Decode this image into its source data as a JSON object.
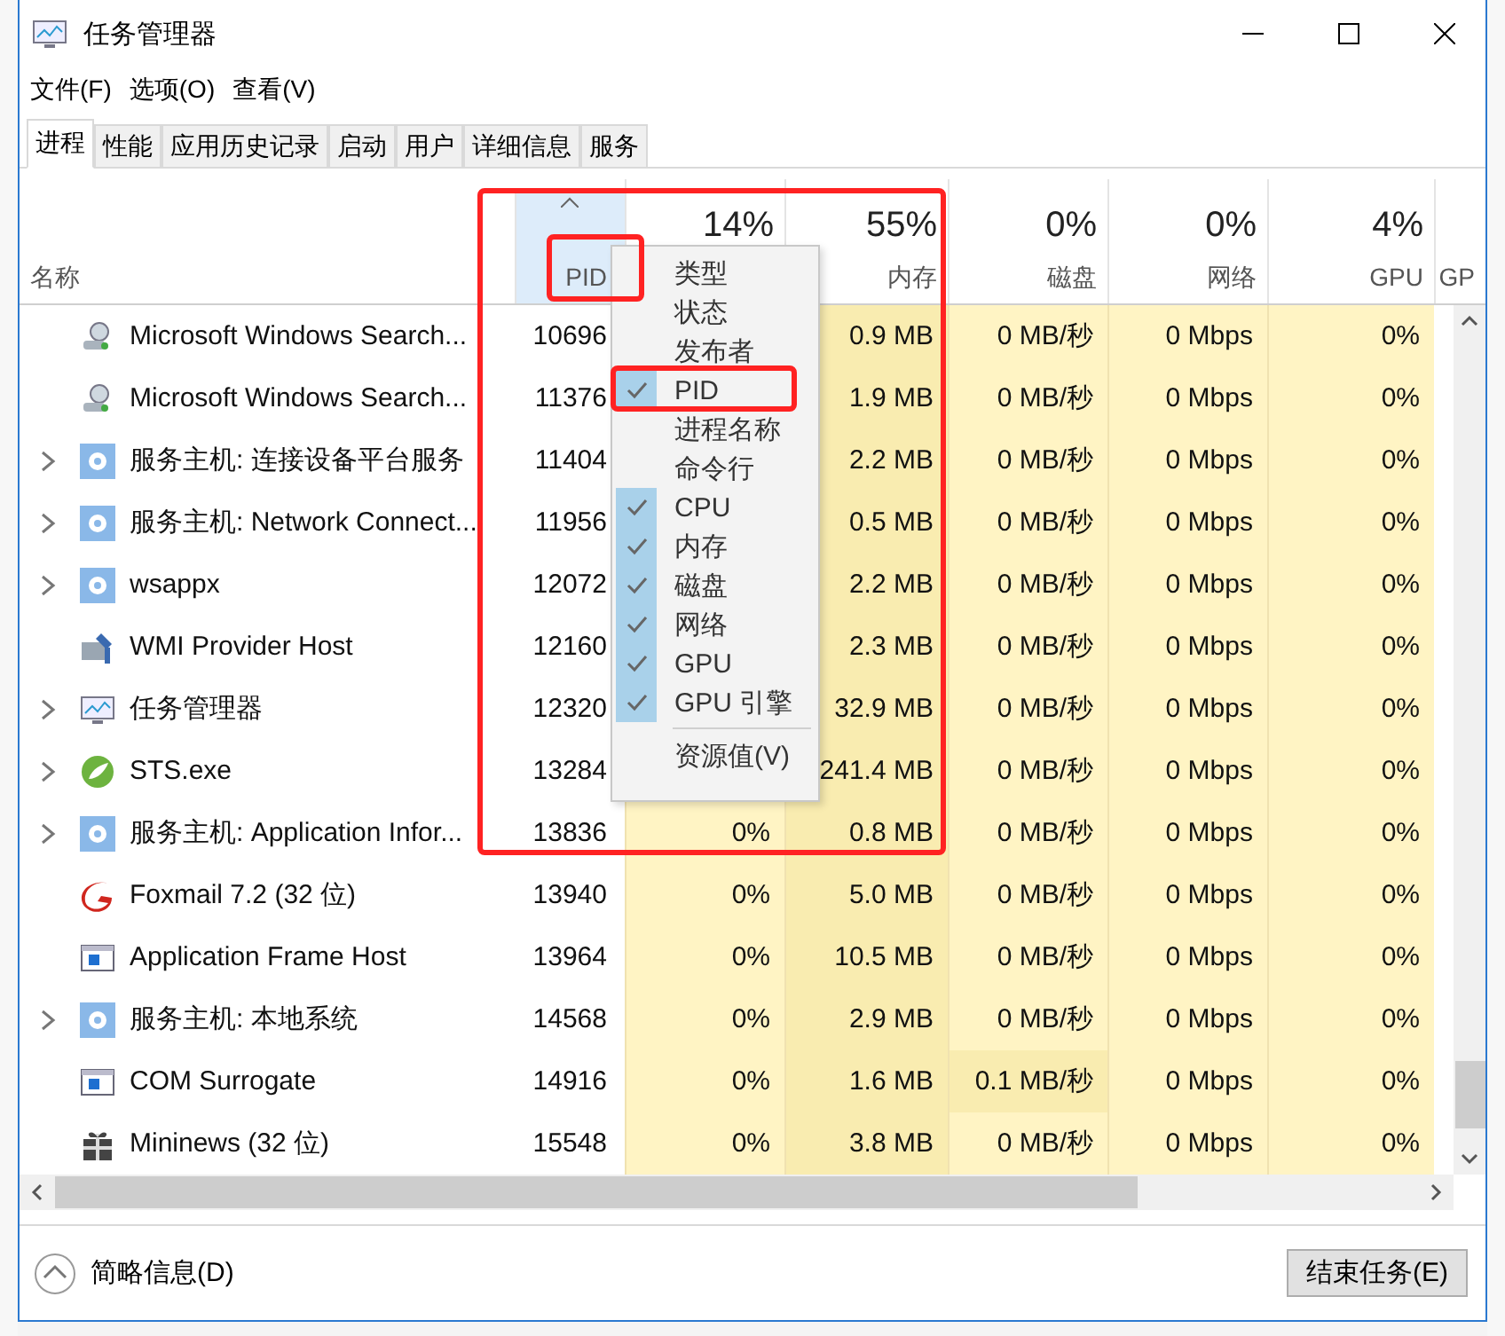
{
  "window": {
    "title": "任务管理器"
  },
  "menu_bar": [
    "文件(F)",
    "选项(O)",
    "查看(V)"
  ],
  "tabs": [
    {
      "label": "进程",
      "selected": true
    },
    {
      "label": "性能",
      "selected": false
    },
    {
      "label": "应用历史记录",
      "selected": false
    },
    {
      "label": "启动",
      "selected": false
    },
    {
      "label": "用户",
      "selected": false
    },
    {
      "label": "详细信息",
      "selected": false
    },
    {
      "label": "服务",
      "selected": false
    }
  ],
  "columns": [
    {
      "label": "名称",
      "sorted": false
    },
    {
      "label": "PID",
      "sorted": true
    },
    {
      "percent": "14%",
      "sorted": false
    },
    {
      "percent": "55%",
      "label": "内存",
      "sorted": false
    },
    {
      "percent": "0%",
      "label": "磁盘",
      "sorted": false
    },
    {
      "percent": "0%",
      "label": "网络",
      "sorted": false
    },
    {
      "percent": "4%",
      "label": "GPU",
      "sorted": false
    },
    {
      "label": "GP",
      "sorted": false
    }
  ],
  "rows": [
    {
      "expandable": false,
      "kind": "search",
      "name": "Microsoft Windows Search...",
      "pid": "10696",
      "memory": "0.9 MB",
      "disk": "0 MB/秒",
      "network": "0 Mbps",
      "gpu": "0%",
      "disk_busy": false
    },
    {
      "expandable": false,
      "kind": "search",
      "name": "Microsoft Windows Search...",
      "pid": "11376",
      "memory": "1.9 MB",
      "disk": "0 MB/秒",
      "network": "0 Mbps",
      "gpu": "0%",
      "disk_busy": false
    },
    {
      "expandable": true,
      "kind": "service",
      "name": "服务主机: 连接设备平台服务",
      "pid": "11404",
      "memory": "2.2 MB",
      "disk": "0 MB/秒",
      "network": "0 Mbps",
      "gpu": "0%",
      "disk_busy": false
    },
    {
      "expandable": true,
      "kind": "service",
      "name": "服务主机: Network Connect...",
      "pid": "11956",
      "memory": "0.5 MB",
      "disk": "0 MB/秒",
      "network": "0 Mbps",
      "gpu": "0%",
      "disk_busy": false
    },
    {
      "expandable": true,
      "kind": "service",
      "name": "wsappx",
      "pid": "12072",
      "memory": "2.2 MB",
      "disk": "0 MB/秒",
      "network": "0 Mbps",
      "gpu": "0%",
      "disk_busy": false
    },
    {
      "expandable": false,
      "kind": "wmi",
      "name": "WMI Provider Host",
      "pid": "12160",
      "memory": "2.3 MB",
      "disk": "0 MB/秒",
      "network": "0 Mbps",
      "gpu": "0%",
      "disk_busy": false
    },
    {
      "expandable": true,
      "kind": "monitor",
      "name": "任务管理器",
      "pid": "12320",
      "memory": "32.9 MB",
      "disk": "0 MB/秒",
      "network": "0 Mbps",
      "gpu": "0%",
      "disk_busy": false
    },
    {
      "expandable": true,
      "kind": "leaf",
      "name": "STS.exe",
      "pid": "13284",
      "memory": "241.4 MB",
      "disk": "0 MB/秒",
      "network": "0 Mbps",
      "gpu": "0%",
      "disk_busy": false
    },
    {
      "expandable": true,
      "kind": "service",
      "name": "服务主机: Application Infor...",
      "pid": "13836",
      "cpu": "0%",
      "memory": "0.8 MB",
      "disk": "0 MB/秒",
      "network": "0 Mbps",
      "gpu": "0%",
      "disk_busy": false
    },
    {
      "expandable": false,
      "kind": "mail",
      "name": "Foxmail 7.2 (32 位)",
      "pid": "13940",
      "cpu": "0%",
      "memory": "5.0 MB",
      "disk": "0 MB/秒",
      "network": "0 Mbps",
      "gpu": "0%",
      "disk_busy": false
    },
    {
      "expandable": false,
      "kind": "frame",
      "name": "Application Frame Host",
      "pid": "13964",
      "cpu": "0%",
      "memory": "10.5 MB",
      "disk": "0 MB/秒",
      "network": "0 Mbps",
      "gpu": "0%",
      "disk_busy": false
    },
    {
      "expandable": true,
      "kind": "service",
      "name": "服务主机: 本地系统",
      "pid": "14568",
      "cpu": "0%",
      "memory": "2.9 MB",
      "disk": "0 MB/秒",
      "network": "0 Mbps",
      "gpu": "0%",
      "disk_busy": false
    },
    {
      "expandable": false,
      "kind": "frame",
      "name": "COM Surrogate",
      "pid": "14916",
      "cpu": "0%",
      "memory": "1.6 MB",
      "disk": "0.1 MB/秒",
      "network": "0 Mbps",
      "gpu": "0%",
      "disk_busy": true
    },
    {
      "expandable": false,
      "kind": "gift",
      "name": "Mininews (32 位)",
      "pid": "15548",
      "cpu": "0%",
      "memory": "3.8 MB",
      "disk": "0 MB/秒",
      "network": "0 Mbps",
      "gpu": "0%",
      "disk_busy": false
    }
  ],
  "context_menu": [
    {
      "label": "类型",
      "checked": false,
      "separator_before": false
    },
    {
      "label": "状态",
      "checked": false,
      "separator_before": false
    },
    {
      "label": "发布者",
      "checked": false,
      "separator_before": false
    },
    {
      "label": "PID",
      "checked": true,
      "separator_before": false
    },
    {
      "label": "进程名称",
      "checked": false,
      "separator_before": false
    },
    {
      "label": "命令行",
      "checked": false,
      "separator_before": false
    },
    {
      "label": "CPU",
      "checked": true,
      "separator_before": false
    },
    {
      "label": "内存",
      "checked": true,
      "separator_before": false
    },
    {
      "label": "磁盘",
      "checked": true,
      "separator_before": false
    },
    {
      "label": "网络",
      "checked": true,
      "separator_before": false
    },
    {
      "label": "GPU",
      "checked": true,
      "separator_before": false
    },
    {
      "label": "GPU 引擎",
      "checked": true,
      "separator_before": false
    },
    {
      "label": "资源值(V)",
      "checked": false,
      "separator_before": true
    }
  ],
  "footer": {
    "details_toggle": "简略信息(D)",
    "end_task_button": "结束任务(E)"
  }
}
